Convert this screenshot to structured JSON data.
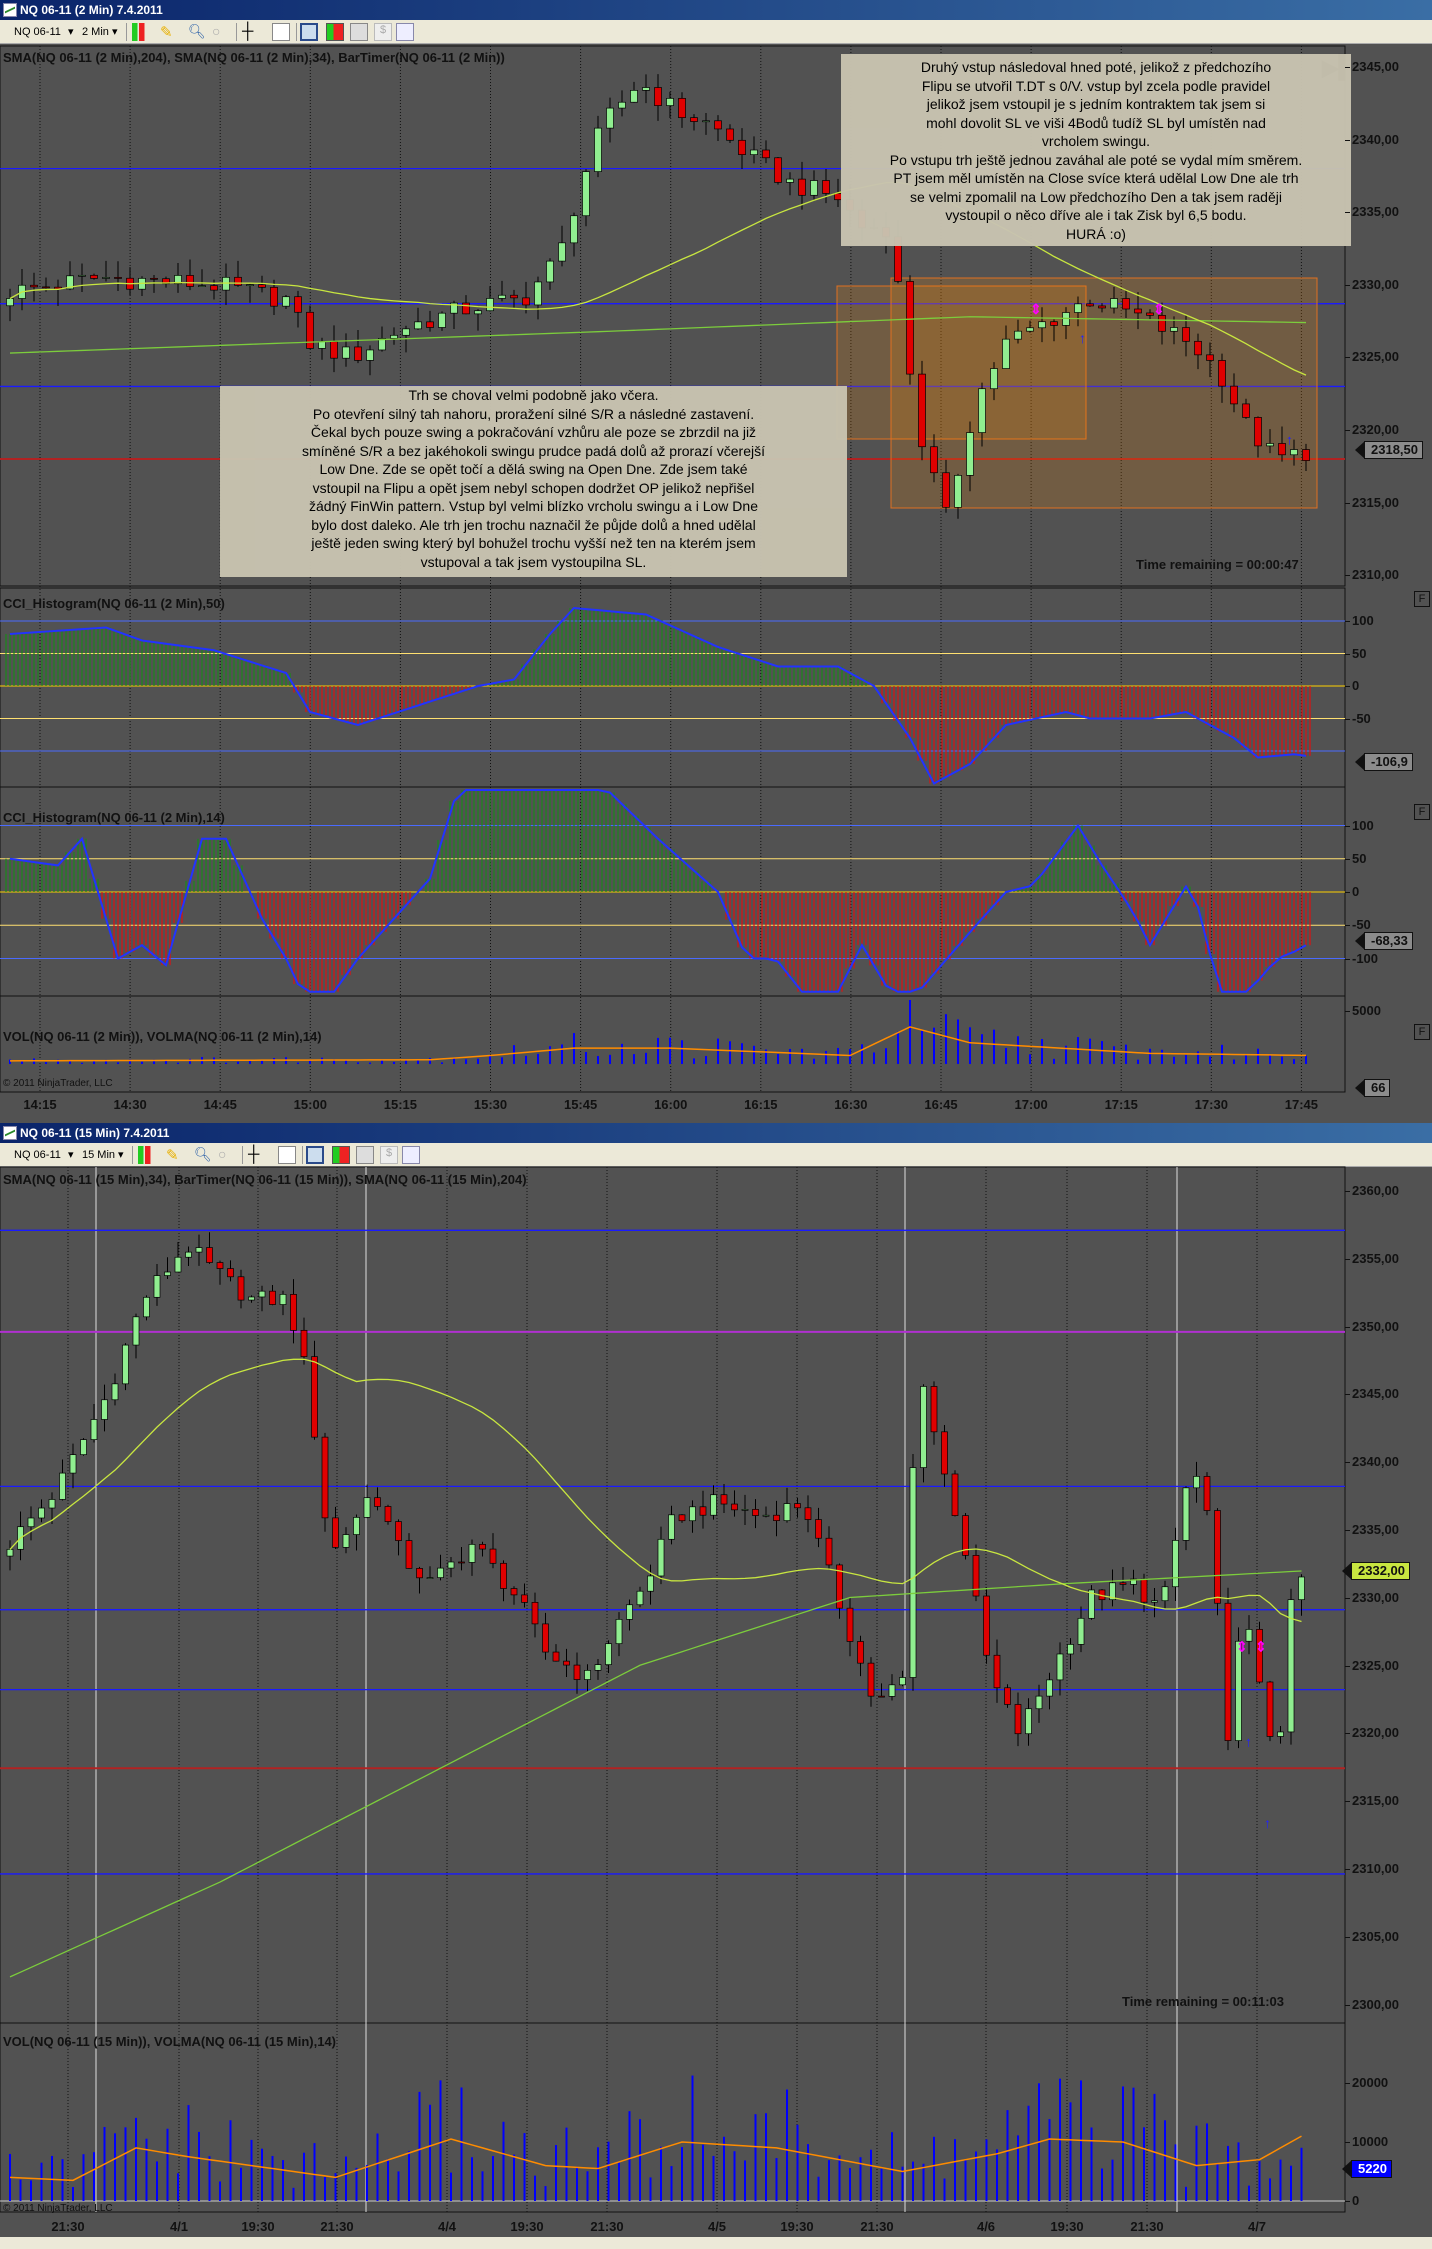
{
  "window1": {
    "title": "NQ 06-11 (2 Min)  7.4.2011",
    "toolbar": {
      "instrument": "NQ 06-11",
      "interval": "2 Min"
    },
    "price_label": "SMA(NQ 06-11 (2 Min),204), SMA(NQ 06-11 (2 Min),34), BarTimer(NQ 06-11 (2 Min))",
    "cci1_label": "CCI_Histogram(NQ 06-11 (2 Min),50)",
    "cci2_label": "CCI_Histogram(NQ 06-11 (2 Min),14)",
    "vol_label": "VOL(NQ 06-11 (2 Min)), VOLMA(NQ 06-11 (2 Min),14)",
    "copyright": "© 2011 NinjaTrader, LLC",
    "time_remaining": "Time remaining = 00:00:47",
    "last_price": "2318,50",
    "cci1_value": "-106,9",
    "cci2_value": "-68,33",
    "vol_value": "66",
    "panel_button": "F",
    "note_right": "Druhý vstup následoval hned poté, jelikož z předchozího\nFlipu se utvořil T.DT s 0/V. vstup byl zcela podle pravidel\njelikož jsem vstoupil je s jedním kontraktem tak jsem si\nmohl dovolit SL ve viši 4Bodů tudíž SL byl umístěn nad\nvrcholem swingu.\nPo vstupu trh ještě jednou zaváhal ale poté se vydal mím směrem.\nPT jsem měl umístěn na Close svíce která udělal Low Dne ale trh\nse velmi zpomalil na Low předchozího Den a tak jsem raději\nvystoupil o něco dříve ale i tak Zisk byl 6,5 bodu.\nHURÁ :o)",
    "note_left": "Trh se choval velmi podobně jako včera.\nPo otevření silný tah nahoru, proražení silné S/R a následné zastavení.\nČekal bych pouze swing a pokračování vzhůru ale poze se zbrzdil na již\nsmíněné S/R a bez jakéhokoli swingu prudce padá dolů až prorazí včerejší\nLow Dne. Zde se opět točí a dělá swing na Open Dne. Zde jsem také\nvstoupil na Flipu a opět jsem nebyl schopen dodržet OP jelikož nepřišel\nžádný FinWin pattern. Vstup byl velmi blízko vrcholu swingu a i Low Dne\nbylo dost daleko. Ale trh jen trochu naznačil že půjde dolů a hned udělal\nještě jeden swing který byl bohužel trochu vyšší než ten na kterém jsem\nvstupoval a tak jsem vystoupilna SL."
  },
  "window2": {
    "title": "NQ 06-11 (15 Min)  7.4.2011",
    "toolbar": {
      "instrument": "NQ 06-11",
      "interval": "15 Min"
    },
    "price_label": "SMA(NQ 06-11 (15 Min),34), BarTimer(NQ 06-11 (15 Min)), SMA(NQ 06-11 (15 Min),204)",
    "vol_label": "VOL(NQ 06-11 (15 Min)), VOLMA(NQ 06-11 (15 Min),14)",
    "copyright": "© 2011 NinjaTrader, LLC",
    "time_remaining": "Time remaining = 00:11:03",
    "last_price": "2332,00",
    "vol_value": "5220"
  },
  "colors": {
    "up": "#90ee90",
    "down": "#e00000",
    "sma_fast": "#c8e640",
    "sma_slow": "#7ccd3c",
    "hline": "#1a1aff",
    "red_line": "#b22222",
    "purple_line": "#b030d0",
    "volma": "#ff8c00",
    "vol": "#0000ff",
    "cci": "#2233ff"
  },
  "chart_data": [
    {
      "type": "candlestick",
      "name": "NQ 06-11 (2 Min)",
      "ylim": [
        2309,
        2347
      ],
      "yticks": [
        "2345,00",
        "2340,00",
        "2335,00",
        "2330,00",
        "2325,00",
        "2320,00",
        "2315,00",
        "2310,00"
      ],
      "xticks": [
        "14:15",
        "14:30",
        "14:45",
        "15:00",
        "15:15",
        "15:30",
        "15:45",
        "16:00",
        "16:15",
        "16:30",
        "16:45",
        "17:00",
        "17:15",
        "17:30",
        "17:45"
      ],
      "bars": 109,
      "close_path": [
        [
          0,
          2329.5
        ],
        [
          7.5,
          2330.5
        ],
        [
          17,
          2330
        ],
        [
          23,
          2329
        ],
        [
          25,
          2326
        ],
        [
          28.5,
          2325
        ],
        [
          32.6,
          2327
        ],
        [
          38.6,
          2328.5
        ],
        [
          42.8,
          2329
        ],
        [
          45.8,
          2332
        ],
        [
          47.6,
          2337
        ],
        [
          49.4,
          2341
        ],
        [
          52.4,
          2344
        ],
        [
          55.4,
          2342
        ],
        [
          58.4,
          2341
        ],
        [
          61.4,
          2339
        ],
        [
          65,
          2337
        ],
        [
          69,
          2336
        ],
        [
          71,
          2334
        ],
        [
          73.3,
          2334
        ],
        [
          74.5,
          2327
        ],
        [
          75.7,
          2320
        ],
        [
          78,
          2314
        ],
        [
          80.5,
          2322
        ],
        [
          83,
          2326
        ],
        [
          85.3,
          2327
        ],
        [
          90,
          2329
        ],
        [
          93.6,
          2328
        ],
        [
          98.4,
          2326
        ],
        [
          100.8,
          2324
        ],
        [
          103.2,
          2320
        ],
        [
          105.6,
          2318
        ],
        [
          108,
          2318.5
        ]
      ],
      "sma204_path": [
        [
          0,
          2325.3
        ],
        [
          50,
          2326.8
        ],
        [
          80,
          2327.8
        ],
        [
          108,
          2327.4
        ]
      ],
      "levels": {
        "blue": [
          2338.0,
          2328.7,
          2323.0
        ],
        "red": [
          2318.0
        ]
      },
      "cci50_path": [
        [
          0,
          80
        ],
        [
          8,
          90
        ],
        [
          11,
          70
        ],
        [
          17,
          55
        ],
        [
          23,
          20
        ],
        [
          25,
          -40
        ],
        [
          29,
          -60
        ],
        [
          34,
          -30
        ],
        [
          39,
          0
        ],
        [
          42,
          10
        ],
        [
          45,
          80
        ],
        [
          47,
          120
        ],
        [
          53,
          110
        ],
        [
          59,
          60
        ],
        [
          64,
          30
        ],
        [
          69,
          30
        ],
        [
          72,
          0
        ],
        [
          75,
          -80
        ],
        [
          77,
          -150
        ],
        [
          80,
          -120
        ],
        [
          83,
          -60
        ],
        [
          88,
          -40
        ],
        [
          90,
          -50
        ],
        [
          95,
          -50
        ],
        [
          98,
          -40
        ],
        [
          102,
          -80
        ],
        [
          104,
          -110
        ],
        [
          107,
          -105
        ],
        [
          109,
          -110
        ]
      ],
      "cci14_path": [
        [
          0,
          50
        ],
        [
          4,
          40
        ],
        [
          6,
          80
        ],
        [
          9,
          -100
        ],
        [
          11,
          -80
        ],
        [
          13,
          -110
        ],
        [
          16,
          80
        ],
        [
          18,
          80
        ],
        [
          21,
          -40
        ],
        [
          23,
          -100
        ],
        [
          24.3,
          -150
        ],
        [
          27,
          -150
        ],
        [
          29,
          -100
        ],
        [
          31.5,
          -50
        ],
        [
          35,
          20
        ],
        [
          37.4,
          160
        ],
        [
          42.5,
          200
        ],
        [
          45,
          160
        ],
        [
          49.4,
          160
        ],
        [
          54,
          80
        ],
        [
          59,
          0
        ],
        [
          61.4,
          -100
        ],
        [
          63.8,
          -100
        ],
        [
          66,
          -150
        ],
        [
          69,
          -150
        ],
        [
          71,
          -80
        ],
        [
          73.3,
          -150
        ],
        [
          75.7,
          -150
        ],
        [
          80.5,
          -50
        ],
        [
          83,
          0
        ],
        [
          85.3,
          10
        ],
        [
          89,
          100
        ],
        [
          91,
          40
        ],
        [
          93.6,
          -30
        ],
        [
          95,
          -80
        ],
        [
          98.4,
          20
        ],
        [
          100.8,
          -150
        ],
        [
          103.2,
          -150
        ],
        [
          105.6,
          -100
        ],
        [
          107,
          -90
        ],
        [
          109,
          -70
        ]
      ],
      "volma_path": [
        [
          0,
          300
        ],
        [
          35,
          400
        ],
        [
          40,
          800
        ],
        [
          47,
          1500
        ],
        [
          55,
          1500
        ],
        [
          70,
          800
        ],
        [
          75,
          3500
        ],
        [
          80,
          2000
        ],
        [
          95,
          1000
        ],
        [
          109,
          800
        ]
      ],
      "vol_ylim": [
        0,
        6000
      ],
      "vol_yticks": [
        "5000"
      ]
    },
    {
      "type": "candlestick",
      "name": "NQ 06-11 (15 Min)",
      "ylim": [
        2298,
        2362
      ],
      "yticks": [
        "2360,00",
        "2355,00",
        "2350,00",
        "2345,00",
        "2340,00",
        "2335,00",
        "2330,00",
        "2325,00",
        "2320,00",
        "2315,00",
        "2310,00",
        "2305,00",
        "2300,00"
      ],
      "xticks": [
        "21:30",
        "4/1",
        "19:30",
        "21:30",
        "4/4",
        "19:30",
        "21:30",
        "4/5",
        "19:30",
        "21:30",
        "4/6",
        "19:30",
        "21:30",
        "4/7"
      ],
      "bars": 124,
      "close_path": [
        [
          0,
          2334
        ],
        [
          4.5,
          2338
        ],
        [
          9.3,
          2345
        ],
        [
          12.7,
          2352
        ],
        [
          16.8,
          2356
        ],
        [
          19.6,
          2354
        ],
        [
          23,
          2352
        ],
        [
          26.4,
          2352
        ],
        [
          28.4,
          2346
        ],
        [
          30.5,
          2333
        ],
        [
          34.6,
          2338
        ],
        [
          37.3,
          2333
        ],
        [
          40.1,
          2331
        ],
        [
          44.1,
          2334
        ],
        [
          48.3,
          2330
        ],
        [
          51,
          2326
        ],
        [
          55.1,
          2324
        ],
        [
          57.8,
          2328
        ],
        [
          60.5,
          2331
        ],
        [
          63.3,
          2336
        ],
        [
          67.4,
          2337
        ],
        [
          71.5,
          2336
        ],
        [
          75.6,
          2337
        ],
        [
          79.7,
          2328
        ],
        [
          82.4,
          2322
        ],
        [
          85.1,
          2324
        ],
        [
          86.5,
          2348
        ],
        [
          88.6,
          2340
        ],
        [
          90.6,
          2335
        ],
        [
          93.4,
          2324
        ],
        [
          96.1,
          2320
        ],
        [
          100.2,
          2326
        ],
        [
          102.9,
          2330
        ],
        [
          107,
          2331
        ],
        [
          109.7,
          2329
        ],
        [
          112.5,
          2340
        ],
        [
          114.5,
          2335
        ],
        [
          115.9,
          2318
        ],
        [
          117.3,
          2330
        ],
        [
          119.3,
          2322
        ],
        [
          120.7,
          2318
        ],
        [
          122.1,
          2330
        ],
        [
          123.4,
          2332
        ]
      ],
      "sma204_path": [
        [
          0,
          2302
        ],
        [
          20,
          2309
        ],
        [
          40,
          2317
        ],
        [
          60,
          2325
        ],
        [
          80,
          2330
        ],
        [
          100,
          2331
        ],
        [
          124,
          2332
        ]
      ],
      "levels": {
        "blue": [
          2357.1,
          2338.2,
          2329.1,
          2323.2,
          2309.6
        ],
        "purple": [
          2349.6
        ],
        "red": [
          2317.4
        ]
      },
      "volma_path": [
        [
          0,
          4000
        ],
        [
          6,
          3500
        ],
        [
          12,
          9000
        ],
        [
          17,
          7500
        ],
        [
          31,
          4000
        ],
        [
          42,
          10500
        ],
        [
          51,
          6000
        ],
        [
          56,
          5500
        ],
        [
          64,
          10000
        ],
        [
          73,
          9000
        ],
        [
          85,
          5000
        ],
        [
          94,
          8000
        ],
        [
          99,
          10500
        ],
        [
          106,
          10000
        ],
        [
          113,
          6000
        ],
        [
          119,
          7000
        ],
        [
          124,
          12000
        ],
        [
          128,
          10000
        ]
      ],
      "vol_ylim": [
        0,
        28000
      ],
      "vol_yticks": [
        "20000",
        "10000",
        "0"
      ]
    }
  ]
}
